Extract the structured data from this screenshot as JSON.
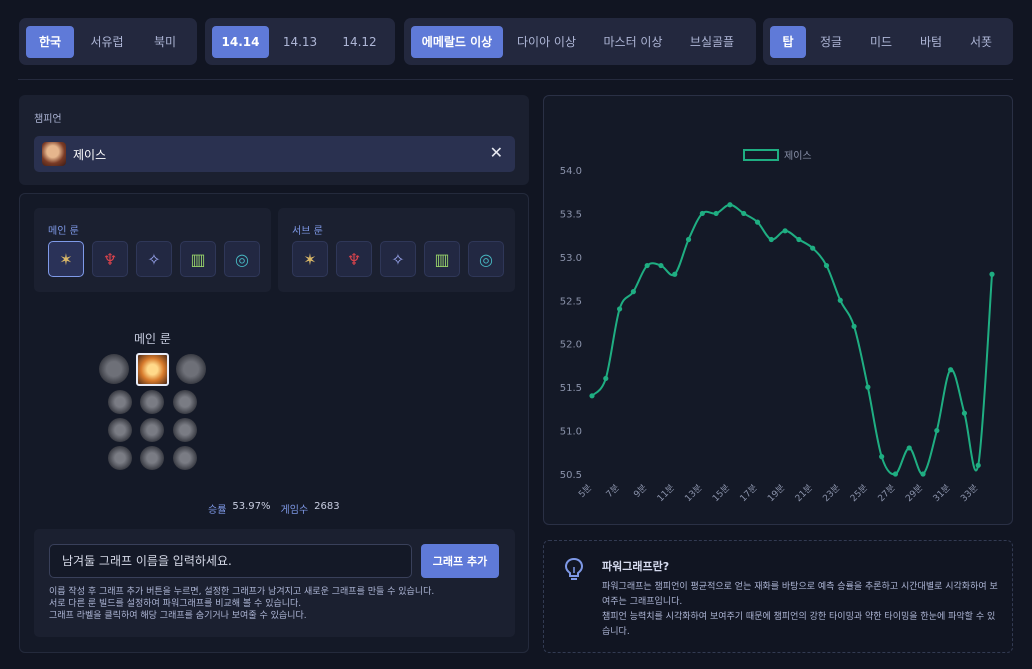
{
  "filters": {
    "region": {
      "options": [
        "한국",
        "서유럽",
        "북미"
      ],
      "selected": 0
    },
    "patch": {
      "options": [
        "14.14",
        "14.13",
        "14.12"
      ],
      "selected": 0
    },
    "tier": {
      "options": [
        "에메랄드 이상",
        "다이아 이상",
        "마스터 이상",
        "브실골플"
      ],
      "selected": 0
    },
    "position": {
      "options": [
        "탑",
        "정글",
        "미드",
        "바텀",
        "서폿"
      ],
      "selected": 0
    }
  },
  "champion": {
    "label": "챔피언",
    "name": "제이스",
    "clear_icon": "close-icon"
  },
  "runes": {
    "main_label": "메인 룬",
    "sub_label": "서브 룬",
    "trees": [
      {
        "name": "정밀",
        "icon": "precision-icon",
        "color": "#d9b767"
      },
      {
        "name": "지배",
        "icon": "domination-icon",
        "color": "#d9434c"
      },
      {
        "name": "마법",
        "icon": "sorcery-icon",
        "color": "#9aa6f0"
      },
      {
        "name": "결의",
        "icon": "resolve-icon",
        "color": "#97d26a"
      },
      {
        "name": "영감",
        "icon": "inspiration-icon",
        "color": "#47b6c0"
      }
    ],
    "main_selected": 0,
    "grid_title": "메인 룬"
  },
  "stats": {
    "winrate_label": "승률",
    "winrate": "53.97%",
    "games_label": "게임수",
    "games": "2683"
  },
  "graph_form": {
    "placeholder": "남겨둘 그래프 이름을 입력하세요.",
    "add_button": "그래프 추가",
    "help_lines": [
      "이름 작성 후 그래프 추가 버튼을 누르면, 설정한 그래프가 남겨지고 새로운 그래프를 만들 수 있습니다.",
      "서로 다른 룬 빌드를 설정하여 파워그래프를 비교해 볼 수 있습니다.",
      "그래프 라벨을 클릭하여 해당 그래프를 숨기거나 보여줄 수 있습니다."
    ]
  },
  "chart_data": {
    "type": "line",
    "series": [
      {
        "name": "제이스",
        "color": "#1fae82",
        "values": [
          51.4,
          51.6,
          52.4,
          52.6,
          52.9,
          52.9,
          52.8,
          53.2,
          53.5,
          53.5,
          53.6,
          53.5,
          53.4,
          53.2,
          53.3,
          53.2,
          53.1,
          52.9,
          52.5,
          52.2,
          51.5,
          50.7,
          50.5,
          50.8,
          50.5,
          51.0,
          51.7,
          51.2,
          50.6,
          52.8
        ]
      }
    ],
    "x": [
      "5분",
      "6분",
      "7분",
      "8분",
      "9분",
      "10분",
      "11분",
      "12분",
      "13분",
      "14분",
      "15분",
      "16분",
      "17분",
      "18분",
      "19분",
      "20분",
      "21분",
      "22분",
      "23분",
      "24분",
      "25분",
      "26분",
      "27분",
      "28분",
      "29분",
      "30분",
      "31분",
      "32분",
      "33분",
      "34분"
    ],
    "x_tick_labels": [
      "5분",
      "7분",
      "9분",
      "11분",
      "13분",
      "15분",
      "17분",
      "19분",
      "21분",
      "23분",
      "25분",
      "27분",
      "29분",
      "31분",
      "33분"
    ],
    "y_ticks": [
      "54.0",
      "53.5",
      "53.0",
      "52.5",
      "52.0",
      "51.5",
      "51.0",
      "50.5"
    ],
    "ylim": [
      50.5,
      54.0
    ],
    "legend": "top-center",
    "grid": false
  },
  "info": {
    "title": "파워그래프란?",
    "lines": [
      "파워그래프는 챔피언이 평균적으로 얻는 재화를 바탕으로 예측 승률을 추론하고 시간대별로 시각화하여 보여주는 그래프입니다.",
      "챔피언 능력치를 시각화하여 보여주기 때문에 챔피언의 강한 타이밍과 약한 타이밍을 한눈에 파악할 수 있습니다."
    ],
    "icon": "lightbulb-icon"
  }
}
